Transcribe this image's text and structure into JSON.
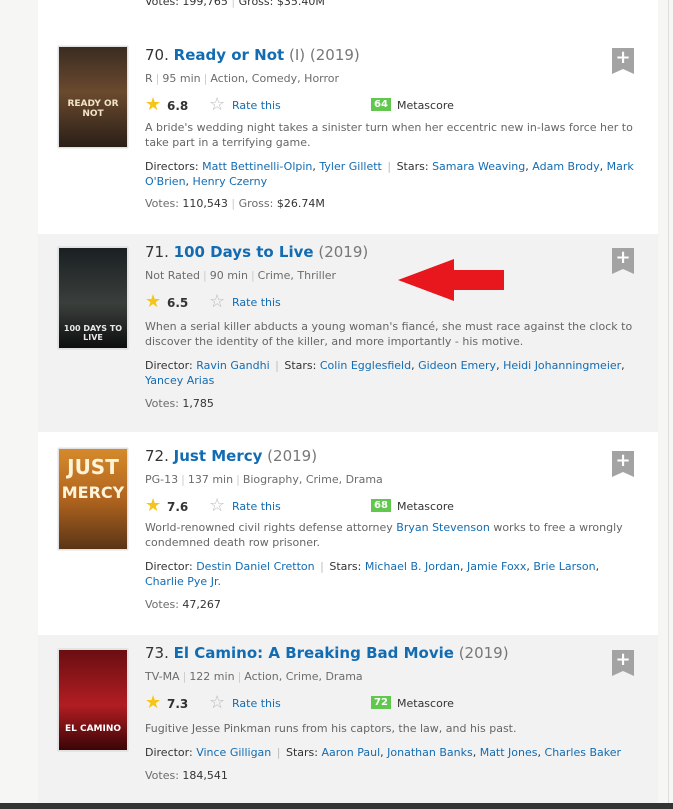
{
  "top_fragment": {
    "votes_label": "Votes:",
    "votes": "199,765",
    "gross_label": "Gross:",
    "gross": "$35.40M"
  },
  "labels": {
    "rate": "Rate this",
    "metascore": "Metascore",
    "votes": "Votes:",
    "gross": "Gross:",
    "director": "Director:",
    "directors": "Directors:",
    "stars": "Stars:",
    "add": "+"
  },
  "movies": [
    {
      "rank": "70.",
      "title": "Ready or Not",
      "qual": "(I)",
      "year": "(2019)",
      "cert": "R",
      "runtime": "95 min",
      "genre": "Action, Comedy, Horror",
      "rating": "6.8",
      "metascore": "64",
      "desc": "A bride's wedding night takes a sinister turn when her eccentric new in-laws force her to take part in a terrifying game.",
      "directors": [
        "Matt Bettinelli-Olpin",
        "Tyler Gillett"
      ],
      "stars": [
        "Samara Weaving",
        "Adam Brody",
        "Mark O'Brien",
        "Henry Czerny"
      ],
      "votes": "110,543",
      "gross": "$26.74M",
      "poster_text": "READY OR NOT"
    },
    {
      "rank": "71.",
      "title": "100 Days to Live",
      "year": "(2019)",
      "cert": "Not Rated",
      "runtime": "90 min",
      "genre": "Crime, Thriller",
      "rating": "6.5",
      "desc": "When a serial killer abducts a young woman's fiancé, she must race against the clock to discover the identity of the killer, and more importantly - his motive.",
      "directors": [
        "Ravin Gandhi"
      ],
      "stars": [
        "Colin Egglesfield",
        "Gideon Emery",
        "Heidi Johanningmeier",
        "Yancey Arias"
      ],
      "votes": "1,785",
      "poster_text": "100 DAYS TO LIVE"
    },
    {
      "rank": "72.",
      "title": "Just Mercy",
      "year": "(2019)",
      "cert": "PG-13",
      "runtime": "137 min",
      "genre": "Biography, Crime, Drama",
      "rating": "7.6",
      "metascore": "68",
      "desc_pre": "World-renowned civil rights defense attorney ",
      "desc_link": "Bryan Stevenson",
      "desc_post": " works to free a wrongly condemned death row prisoner.",
      "directors": [
        "Destin Daniel Cretton"
      ],
      "stars": [
        "Michael B. Jordan",
        "Jamie Foxx",
        "Brie Larson",
        "Charlie Pye Jr."
      ],
      "votes": "47,267",
      "poster_text_1": "JUST",
      "poster_text_2": "MERCY"
    },
    {
      "rank": "73.",
      "title": "El Camino: A Breaking Bad Movie",
      "year": "(2019)",
      "cert": "TV-MA",
      "runtime": "122 min",
      "genre": "Action, Crime, Drama",
      "rating": "7.3",
      "metascore": "72",
      "desc": "Fugitive Jesse Pinkman runs from his captors, the law, and his past.",
      "directors": [
        "Vince Gilligan"
      ],
      "stars": [
        "Aaron Paul",
        "Jonathan Banks",
        "Matt Jones",
        "Charles Baker"
      ],
      "votes": "184,541",
      "poster_text": "EL CAMINO"
    }
  ],
  "colors": {
    "link": "#136cb2",
    "metascore_green": "#61c74f",
    "star_gold": "#f5c518",
    "arrow_red": "#e8161d"
  }
}
